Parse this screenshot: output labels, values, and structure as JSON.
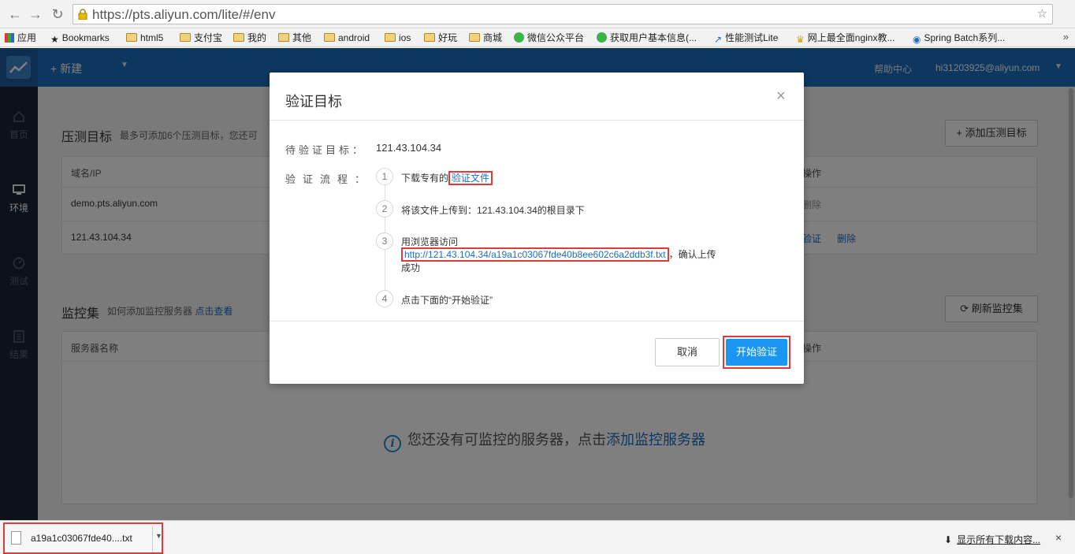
{
  "browser": {
    "url": "https://pts.aliyun.com/lite/#/env",
    "bookmarks": [
      "应用",
      "Bookmarks",
      "html5",
      "支付宝",
      "我的",
      "其他",
      "android",
      "ios",
      "好玩",
      "商城",
      "微信公众平台",
      "获取用户基本信息(...",
      "性能测试Lite",
      "网上最全面nginx教...",
      "Spring Batch系列..."
    ]
  },
  "header": {
    "new_label": "+ 新建",
    "help": "帮助中心",
    "user": "hi31203925@aliyun.com"
  },
  "sidebar": {
    "items": [
      {
        "label": "首页",
        "icon": "home-icon"
      },
      {
        "label": "环境",
        "icon": "monitor-icon"
      },
      {
        "label": "测试",
        "icon": "gauge-icon"
      },
      {
        "label": "结果",
        "icon": "document-icon"
      }
    ]
  },
  "targets": {
    "title": "压测目标",
    "subtitle": "最多可添加6个压测目标，您还可",
    "add_button": "添加压测目标",
    "col_domain": "域名/IP",
    "col_ops": "操作",
    "rows": [
      {
        "domain": "demo.pts.aliyun.com",
        "op1": "删除",
        "op2": ""
      },
      {
        "domain": "121.43.104.34",
        "op1": "验证",
        "op2": "删除"
      }
    ]
  },
  "monitor": {
    "title": "监控集",
    "subtitle": "如何添加监控服务器",
    "subtitle_link": "点击查看",
    "refresh_button": "刷新监控集",
    "col_name": "服务器名称",
    "col_ops": "操作",
    "empty_text": "您还没有可监控的服务器，点击",
    "empty_link": "添加监控服务器"
  },
  "modal": {
    "title": "验证目标",
    "close": "×",
    "target_label": "待验证目标：",
    "target_value": "121.43.104.34",
    "flow_label": "验证流程：",
    "steps": [
      {
        "num": "1",
        "text": "下载专有的",
        "link": "验证文件"
      },
      {
        "num": "2",
        "text": "将该文件上传到：121.43.104.34的根目录下"
      },
      {
        "num": "3",
        "text": "用浏览器访问",
        "url": "http://121.43.104.34/a19a1c03067fde40b8ee602c6a2ddb3f.txt",
        "suffix": "，确认上传",
        "tail": "成功"
      },
      {
        "num": "4",
        "text": "点击下面的“开始验证”"
      }
    ],
    "cancel": "取消",
    "start": "开始验证"
  },
  "downloads": {
    "file_name": "a19a1c03067fde40....txt",
    "show_all": "显示所有下载内容...",
    "close": "×"
  }
}
